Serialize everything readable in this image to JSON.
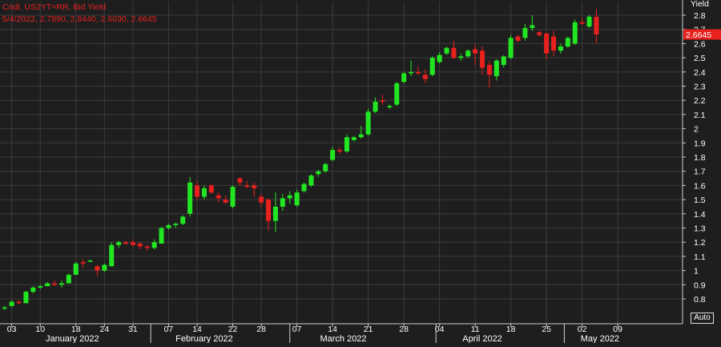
{
  "legend": {
    "line1": "Cndl, US2YT=RR, Bid Yield",
    "line2": "5/4/2022, 2.7890, 2.8440, 2.6030, 2.6645"
  },
  "auto_label": "Auto",
  "colors": {
    "background": "#1e1e1e",
    "up": "#22e622",
    "down": "#e8201e",
    "grid": "#3c3c3c",
    "text": "#ffffff",
    "last_price_tag": "#e8201e"
  },
  "chart_data": {
    "type": "candlestick",
    "title": "",
    "ylabel": "Yield",
    "ylim": [
      0.7,
      2.9
    ],
    "y_ticks": [
      "0.8",
      "0.9",
      "1",
      "1.1",
      "1.2",
      "1.3",
      "1.4",
      "1.5",
      "1.6",
      "1.7",
      "1.8",
      "1.9",
      "2",
      "2.1",
      "2.2",
      "2.3",
      "2.4",
      "2.5",
      "2.6",
      "2.7",
      "2.8"
    ],
    "last_value_label": "2.6645",
    "last_value": 2.6645,
    "x_day_ticks": [
      "03",
      "10",
      "18",
      "24",
      "31",
      "07",
      "14",
      "22",
      "28",
      "07",
      "14",
      "21",
      "28",
      "04",
      "11",
      "18",
      "25",
      "02",
      "09"
    ],
    "x_day_tick_index": [
      1,
      5,
      10,
      14,
      18,
      23,
      27,
      32,
      36,
      41,
      46,
      51,
      56,
      61,
      66,
      71,
      76,
      81,
      86
    ],
    "x_month_labels": [
      "January 2022",
      "February 2022",
      "March 2022",
      "April 2022",
      "May 2022"
    ],
    "x_month_center_index": [
      9.5,
      28,
      47.5,
      67,
      83.5
    ],
    "x_month_separators": [
      20.5,
      40,
      60.5,
      78.5
    ],
    "grid": true,
    "candles": [
      [
        0.74,
        0.75,
        0.72,
        0.74
      ],
      [
        0.75,
        0.79,
        0.74,
        0.78
      ],
      [
        0.78,
        0.79,
        0.76,
        0.77
      ],
      [
        0.77,
        0.86,
        0.77,
        0.85
      ],
      [
        0.85,
        0.89,
        0.84,
        0.88
      ],
      [
        0.88,
        0.9,
        0.87,
        0.89
      ],
      [
        0.89,
        0.92,
        0.89,
        0.91
      ],
      [
        0.91,
        0.93,
        0.89,
        0.9
      ],
      [
        0.9,
        0.93,
        0.88,
        0.91
      ],
      [
        0.91,
        0.98,
        0.91,
        0.97
      ],
      [
        0.97,
        1.06,
        0.97,
        1.05
      ],
      [
        1.06,
        1.08,
        1.02,
        1.05
      ],
      [
        1.07,
        1.08,
        1.06,
        1.07
      ],
      [
        1.03,
        1.04,
        0.96,
        1.0
      ],
      [
        1.0,
        1.05,
        0.99,
        1.04
      ],
      [
        1.03,
        1.2,
        1.03,
        1.18
      ],
      [
        1.18,
        1.21,
        1.16,
        1.2
      ],
      [
        1.2,
        1.21,
        1.18,
        1.19
      ],
      [
        1.2,
        1.22,
        1.17,
        1.18
      ],
      [
        1.19,
        1.2,
        1.15,
        1.17
      ],
      [
        1.17,
        1.18,
        1.14,
        1.16
      ],
      [
        1.16,
        1.22,
        1.15,
        1.2
      ],
      [
        1.19,
        1.31,
        1.19,
        1.3
      ],
      [
        1.3,
        1.33,
        1.29,
        1.32
      ],
      [
        1.32,
        1.34,
        1.3,
        1.33
      ],
      [
        1.33,
        1.39,
        1.32,
        1.38
      ],
      [
        1.4,
        1.66,
        1.38,
        1.62
      ],
      [
        1.6,
        1.63,
        1.5,
        1.52
      ],
      [
        1.52,
        1.6,
        1.5,
        1.58
      ],
      [
        1.6,
        1.61,
        1.54,
        1.55
      ],
      [
        1.53,
        1.55,
        1.48,
        1.51
      ],
      [
        1.5,
        1.53,
        1.47,
        1.48
      ],
      [
        1.45,
        1.6,
        1.44,
        1.59
      ],
      [
        1.65,
        1.66,
        1.6,
        1.62
      ],
      [
        1.6,
        1.63,
        1.58,
        1.59
      ],
      [
        1.6,
        1.62,
        1.52,
        1.58
      ],
      [
        1.52,
        1.54,
        1.45,
        1.48
      ],
      [
        1.5,
        1.51,
        1.28,
        1.35
      ],
      [
        1.35,
        1.55,
        1.27,
        1.45
      ],
      [
        1.45,
        1.54,
        1.42,
        1.51
      ],
      [
        1.51,
        1.56,
        1.47,
        1.53
      ],
      [
        1.46,
        1.57,
        1.45,
        1.55
      ],
      [
        1.56,
        1.62,
        1.55,
        1.61
      ],
      [
        1.6,
        1.68,
        1.59,
        1.67
      ],
      [
        1.68,
        1.71,
        1.66,
        1.7
      ],
      [
        1.7,
        1.76,
        1.69,
        1.75
      ],
      [
        1.78,
        1.87,
        1.77,
        1.85
      ],
      [
        1.85,
        1.87,
        1.82,
        1.84
      ],
      [
        1.84,
        1.96,
        1.83,
        1.94
      ],
      [
        1.92,
        1.95,
        1.91,
        1.94
      ],
      [
        1.94,
        2.02,
        1.93,
        1.96
      ],
      [
        1.96,
        2.14,
        1.95,
        2.12
      ],
      [
        2.12,
        2.22,
        2.11,
        2.19
      ],
      [
        2.2,
        2.24,
        2.17,
        2.19
      ],
      [
        2.15,
        2.17,
        2.14,
        2.16
      ],
      [
        2.17,
        2.33,
        2.16,
        2.32
      ],
      [
        2.33,
        2.4,
        2.32,
        2.39
      ],
      [
        2.39,
        2.48,
        2.37,
        2.4
      ],
      [
        2.4,
        2.44,
        2.38,
        2.39
      ],
      [
        2.38,
        2.42,
        2.32,
        2.35
      ],
      [
        2.38,
        2.51,
        2.37,
        2.5
      ],
      [
        2.47,
        2.54,
        2.46,
        2.52
      ],
      [
        2.53,
        2.58,
        2.52,
        2.57
      ],
      [
        2.57,
        2.62,
        2.49,
        2.5
      ],
      [
        2.5,
        2.53,
        2.48,
        2.51
      ],
      [
        2.51,
        2.56,
        2.5,
        2.55
      ],
      [
        2.56,
        2.59,
        2.45,
        2.53
      ],
      [
        2.55,
        2.58,
        2.38,
        2.43
      ],
      [
        2.45,
        2.48,
        2.29,
        2.38
      ],
      [
        2.37,
        2.49,
        2.34,
        2.48
      ],
      [
        2.45,
        2.52,
        2.43,
        2.51
      ],
      [
        2.5,
        2.66,
        2.49,
        2.64
      ],
      [
        2.65,
        2.66,
        2.61,
        2.62
      ],
      [
        2.64,
        2.74,
        2.62,
        2.71
      ],
      [
        2.71,
        2.8,
        2.69,
        2.73
      ],
      [
        2.68,
        2.69,
        2.65,
        2.66
      ],
      [
        2.67,
        2.68,
        2.49,
        2.53
      ],
      [
        2.65,
        2.69,
        2.51,
        2.55
      ],
      [
        2.55,
        2.6,
        2.53,
        2.58
      ],
      [
        2.58,
        2.65,
        2.57,
        2.64
      ],
      [
        2.6,
        2.77,
        2.59,
        2.75
      ],
      [
        2.75,
        2.78,
        2.73,
        2.74
      ],
      [
        2.72,
        2.8,
        2.71,
        2.79
      ],
      [
        2.789,
        2.844,
        2.603,
        2.6645
      ]
    ]
  }
}
